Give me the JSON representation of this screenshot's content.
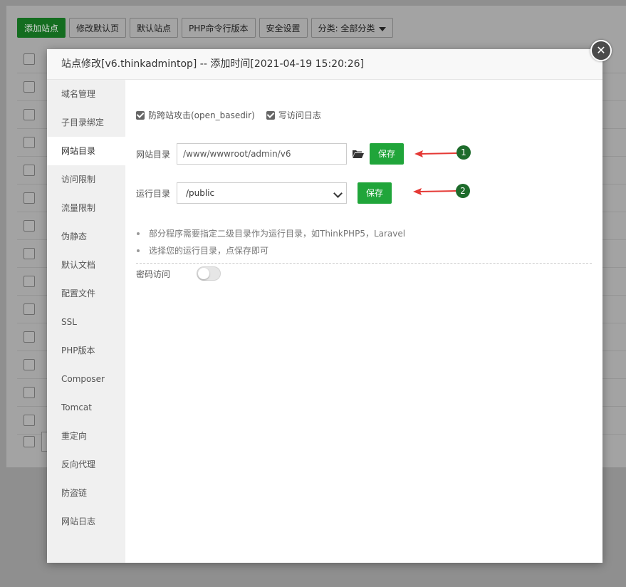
{
  "toolbar": {
    "add_site": "添加站点",
    "edit_default_page": "修改默认页",
    "default_site": "默认站点",
    "php_cli_version": "PHP命令行版本",
    "security_settings": "安全设置",
    "category": "分类: 全部分类"
  },
  "modal": {
    "title": "站点修改[v6.thinkadmintop] -- 添加时间[2021-04-19 15:20:26]",
    "close_glyph": "✕"
  },
  "sidebar": {
    "items": [
      {
        "label": "域名管理"
      },
      {
        "label": "子目录绑定"
      },
      {
        "label": "网站目录"
      },
      {
        "label": "访问限制"
      },
      {
        "label": "流量限制"
      },
      {
        "label": "伪静态"
      },
      {
        "label": "默认文档"
      },
      {
        "label": "配置文件"
      },
      {
        "label": "SSL"
      },
      {
        "label": "PHP版本"
      },
      {
        "label": "Composer"
      },
      {
        "label": "Tomcat"
      },
      {
        "label": "重定向"
      },
      {
        "label": "反向代理"
      },
      {
        "label": "防盗链"
      },
      {
        "label": "网站日志"
      }
    ],
    "active_index": 2
  },
  "site_dir": {
    "anti_xss_label": "防跨站攻击(open_basedir)",
    "anti_xss_checked": true,
    "write_log_label": "写访问日志",
    "write_log_checked": true,
    "dir_label": "网站目录",
    "dir_value": "/www/wwwroot/admin/v6",
    "dir_save": "保存",
    "run_dir_label": "运行目录",
    "run_dir_value": "/public",
    "run_dir_save": "保存",
    "notes": [
      "部分程序需要指定二级目录作为运行目录，如ThinkPHP5，Laravel",
      "选择您的运行目录，点保存即可"
    ],
    "password_access_label": "密码访问",
    "password_access_enabled": false
  },
  "annotations": {
    "badge_1": "1",
    "badge_2": "2",
    "arrow_color": "#e53935",
    "badge_color": "#1d6b2b"
  },
  "colors": {
    "primary": "#20a53a",
    "overlay": "#8f8f8f"
  }
}
